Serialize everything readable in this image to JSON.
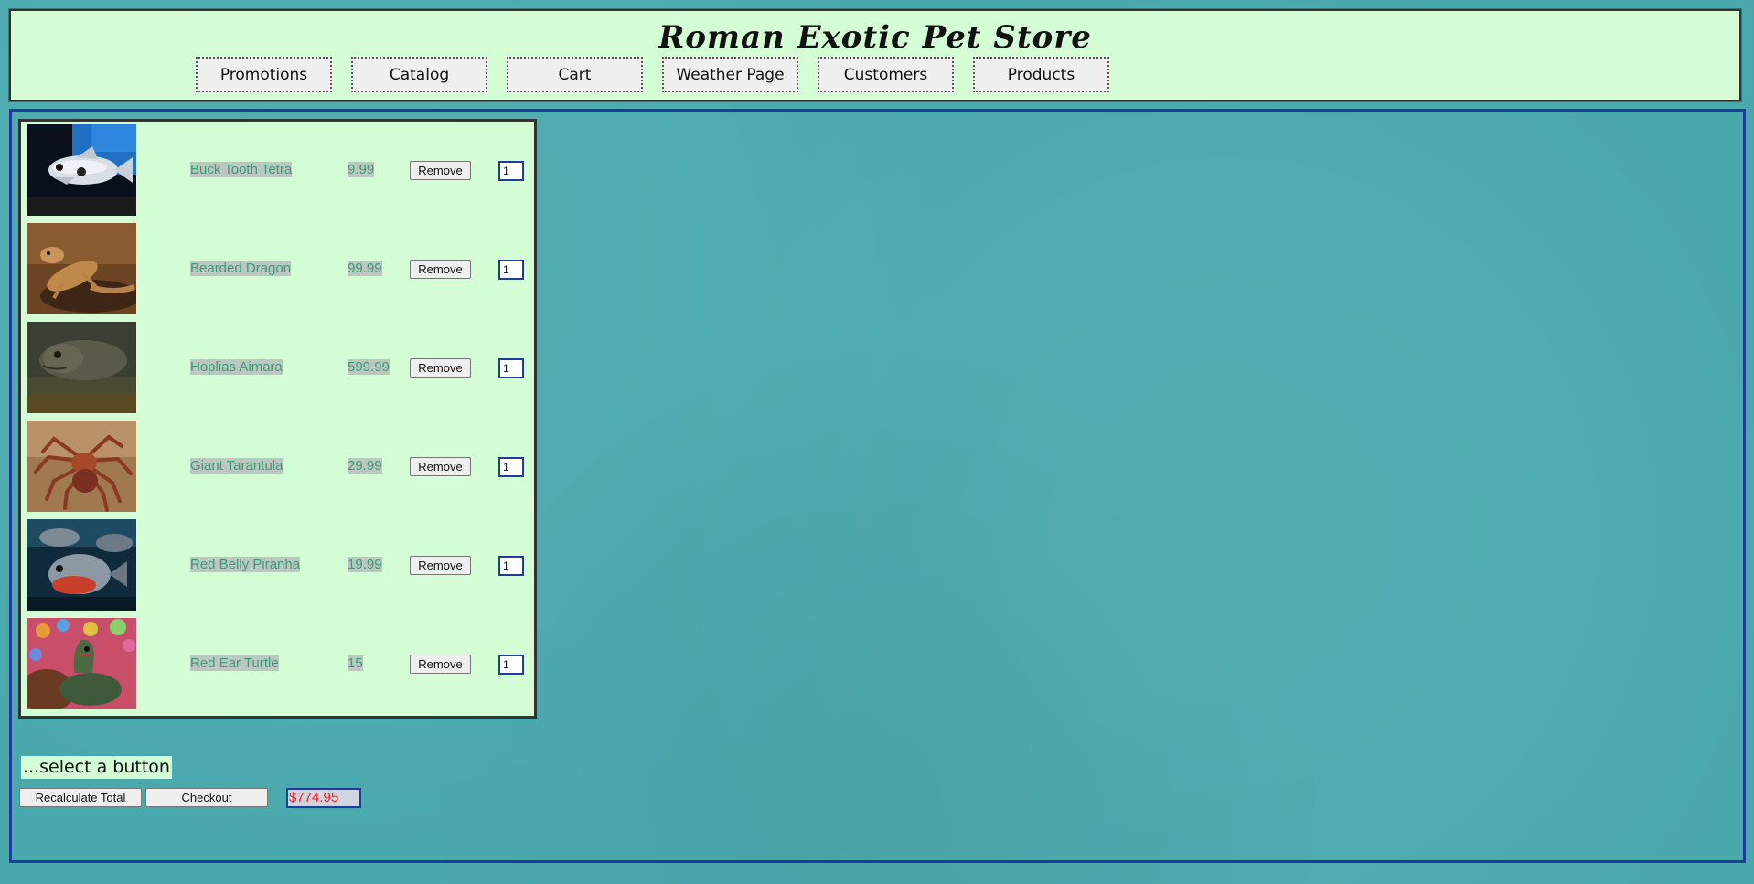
{
  "header": {
    "title": "Roman Exotic Pet Store",
    "nav": [
      {
        "label": "Promotions"
      },
      {
        "label": "Catalog"
      },
      {
        "label": "Cart"
      },
      {
        "label": "Weather Page"
      },
      {
        "label": "Customers"
      },
      {
        "label": "Products"
      }
    ]
  },
  "cart": {
    "items": [
      {
        "name": "Buck Tooth Tetra",
        "price": "9.99",
        "remove_label": "Remove",
        "quantity": "1",
        "image": "fish-photo"
      },
      {
        "name": "Bearded Dragon",
        "price": "99.99",
        "remove_label": "Remove",
        "quantity": "1",
        "image": "lizard-photo"
      },
      {
        "name": "Hoplias Aimara",
        "price": "599.99",
        "remove_label": "Remove",
        "quantity": "1",
        "image": "fish-photo"
      },
      {
        "name": "Giant Tarantula",
        "price": "29.99",
        "remove_label": "Remove",
        "quantity": "1",
        "image": "spider-photo"
      },
      {
        "name": "Red Belly Piranha",
        "price": "19.99",
        "remove_label": "Remove",
        "quantity": "1",
        "image": "fish-photo"
      },
      {
        "name": "Red Ear Turtle",
        "price": "15",
        "remove_label": "Remove",
        "quantity": "1",
        "image": "turtle-photo"
      }
    ]
  },
  "footer": {
    "status_message": "...select a button",
    "recalculate_label": "Recalculate Total",
    "checkout_label": "Checkout",
    "total": "$774.95"
  },
  "colors": {
    "page_background": "#4aa9ad",
    "panel_background": "#d5fdd5",
    "border_blue": "#1e3c9c",
    "item_text": "#3a9e70",
    "total_text": "#ff1a1a"
  }
}
